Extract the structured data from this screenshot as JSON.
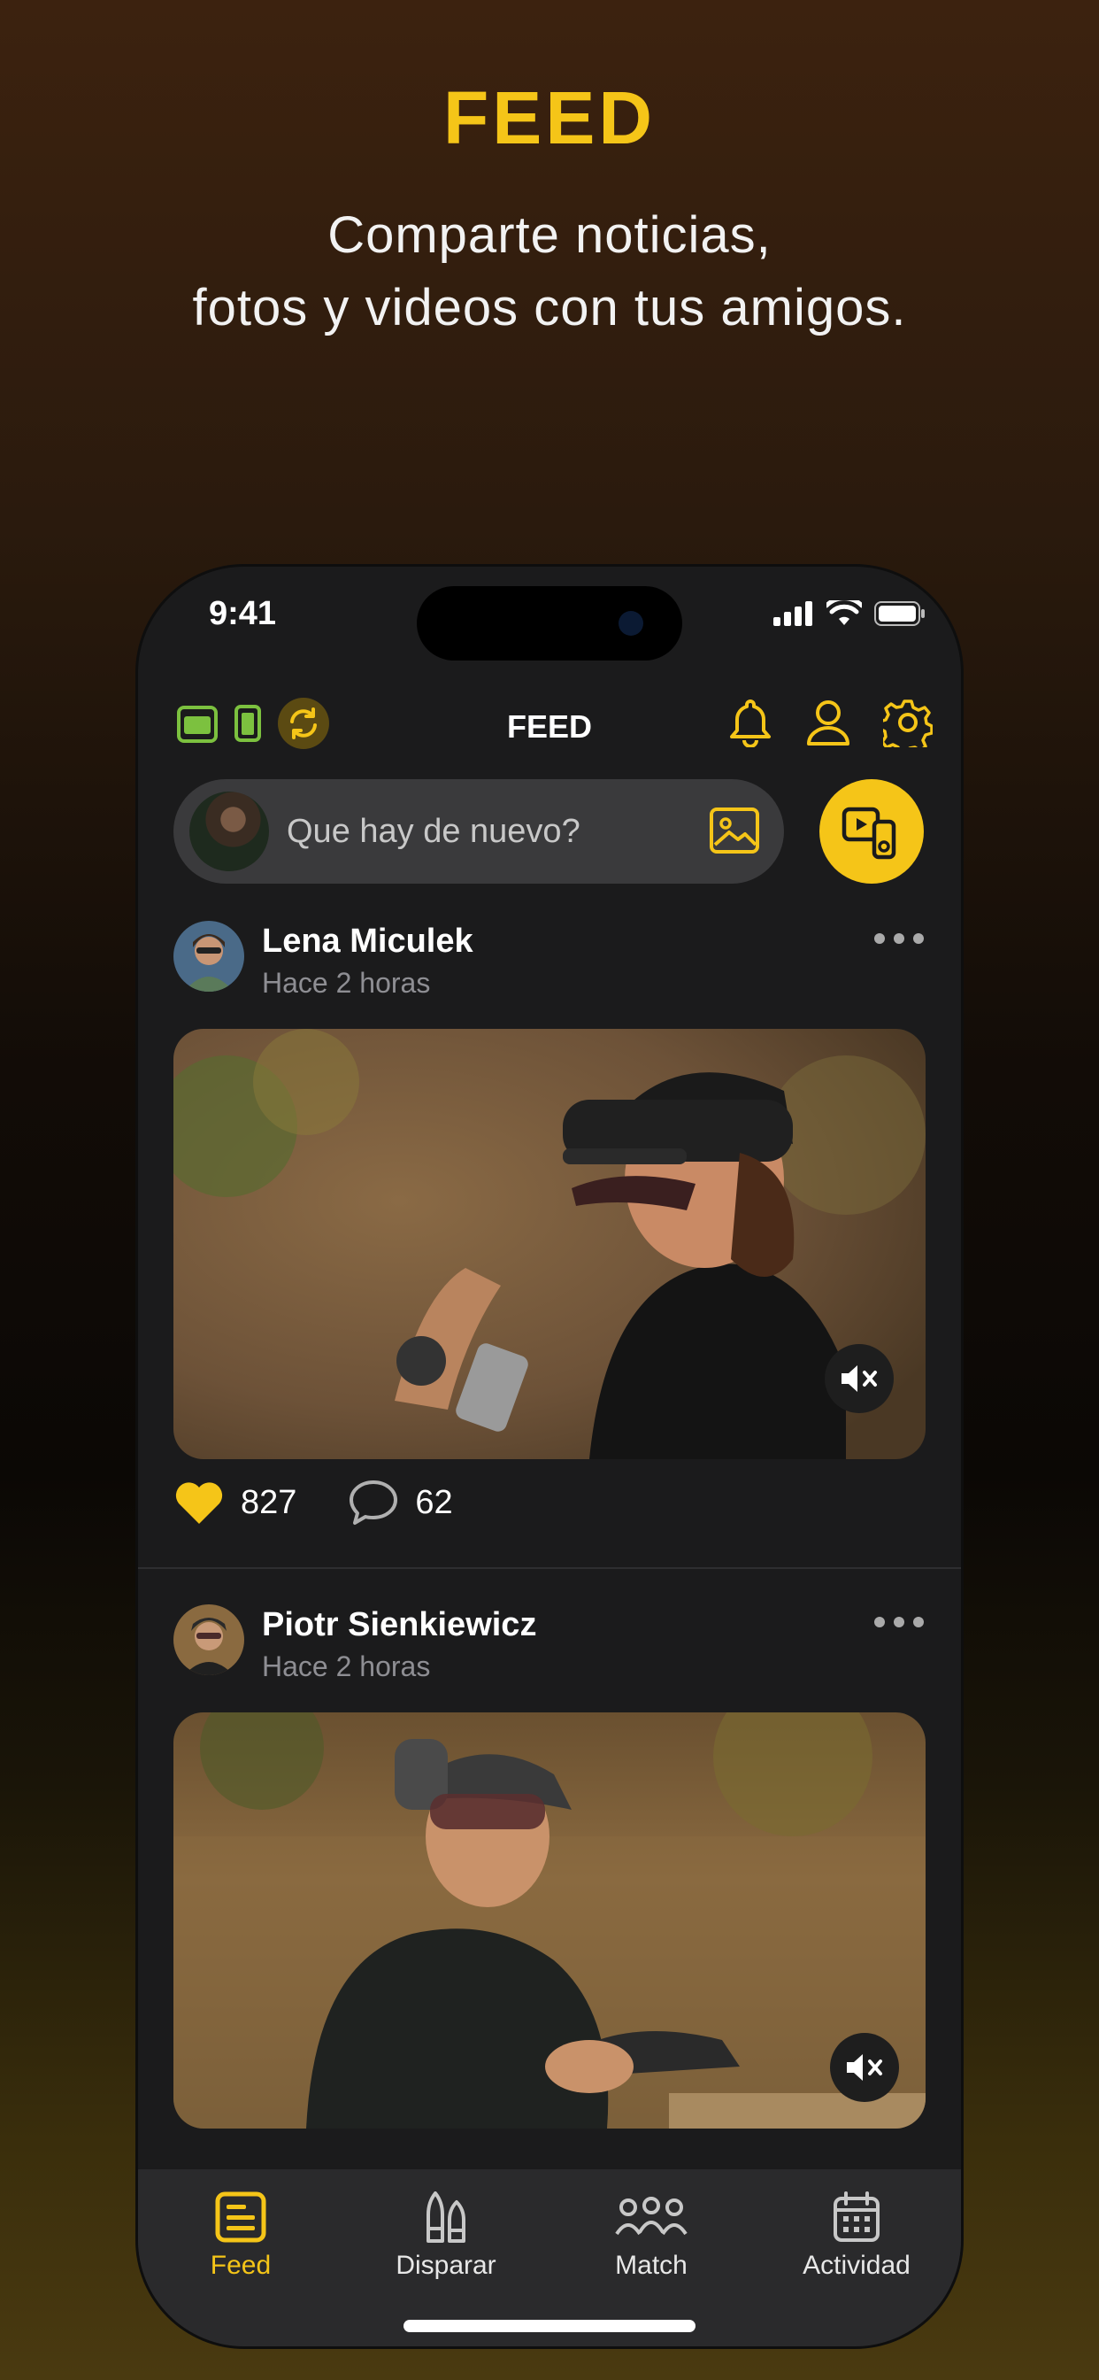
{
  "hero": {
    "title": "FEED",
    "subtitle_line1": "Comparte noticias,",
    "subtitle_line2": "fotos y videos con tus amigos."
  },
  "status_bar": {
    "time": "9:41"
  },
  "top_bar": {
    "title": "FEED",
    "icons": [
      "wallet-icon",
      "battery-device-icon",
      "sync-icon",
      "bell-icon",
      "profile-icon",
      "settings-icon"
    ]
  },
  "composer": {
    "placeholder": "Que hay de nuevo?",
    "image_icon": "image-icon",
    "video_icon": "video-device-icon"
  },
  "posts": [
    {
      "author": "Lena Miculek",
      "time": "Hace 2 horas",
      "likes": "827",
      "comments": "62",
      "muted": true
    },
    {
      "author": "Piotr Sienkiewicz",
      "time": "Hace 2 horas",
      "likes": "",
      "comments": "",
      "muted": true
    }
  ],
  "tab_bar": {
    "items": [
      {
        "label": "Feed",
        "icon": "feed-icon",
        "active": true
      },
      {
        "label": "Disparar",
        "icon": "bullets-icon",
        "active": false
      },
      {
        "label": "Match",
        "icon": "group-icon",
        "active": false
      },
      {
        "label": "Actividad",
        "icon": "calendar-icon",
        "active": false
      }
    ]
  },
  "colors": {
    "accent": "#f5c518",
    "surface": "#1b1b1c",
    "green": "#7cc13f"
  }
}
